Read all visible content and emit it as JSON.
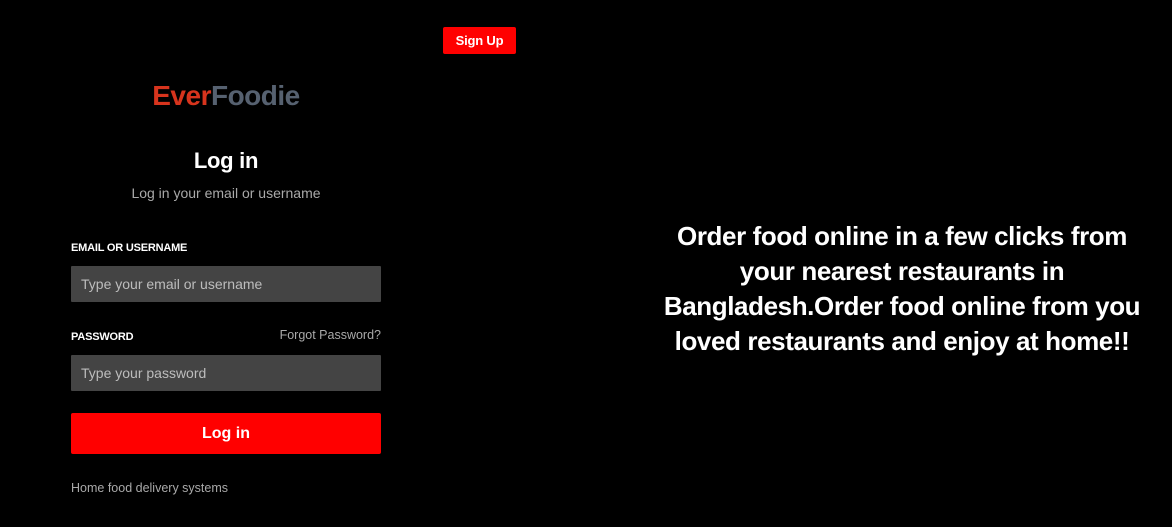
{
  "header": {
    "signup_label": "Sign Up"
  },
  "brand": {
    "ever": "Ever",
    "foodie": "Foodie",
    "ever_color": "#d7341d",
    "foodie_color": "#566170"
  },
  "login": {
    "title": "Log in",
    "subtitle": "Log in your email or username",
    "email_label": "EMAIL OR USERNAME",
    "email_placeholder": "Type your email or username",
    "email_value": "",
    "password_label": "PASSWORD",
    "forgot_password": "Forgot Password?",
    "password_placeholder": "Type your password",
    "password_value": "",
    "submit_label": "Log in",
    "footer": "Home food delivery systems"
  },
  "hero": {
    "tagline": "Order food online in a few clicks from your nearest restaurants in Bangladesh.Order food online from you loved restaurants and enjoy at home!!"
  },
  "colors": {
    "background": "#000000",
    "accent": "#ff0000",
    "input_bg": "#444444",
    "muted_text": "#a9a9a9"
  }
}
